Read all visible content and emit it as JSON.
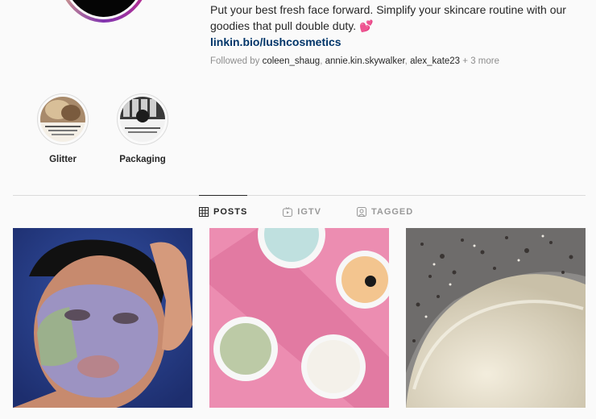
{
  "profile": {
    "bio_line1": "Put your best fresh face forward. Simplify your skincare routine with our",
    "bio_line2": "goodies that pull double duty. 💕",
    "link": "linkin.bio/lushcosmetics",
    "followed_prefix": "Followed by",
    "followed_user1": "coleen_shaug",
    "followed_user2": "annie.kin.skywalker",
    "followed_user3": "alex_kate23",
    "followed_more": "+ 3 more"
  },
  "highlights": [
    {
      "label": "Glitter",
      "icon": "glitter-highlight-thumbnail"
    },
    {
      "label": "Packaging",
      "icon": "packaging-highlight-thumbnail"
    }
  ],
  "tabs": [
    {
      "label": "POSTS",
      "icon": "grid-icon",
      "active": true
    },
    {
      "label": "IGTV",
      "icon": "igtv-icon",
      "active": false
    },
    {
      "label": "TAGGED",
      "icon": "tagged-icon",
      "active": false
    }
  ],
  "posts": [
    {
      "name": "face-mask-photo"
    },
    {
      "name": "pots-on-pink-photo"
    },
    {
      "name": "scrub-texture-photo"
    }
  ],
  "colors": {
    "link": "#003569",
    "muted": "#8e8e8e",
    "divider": "#dbdbdb",
    "pink": "#ec8db1"
  }
}
